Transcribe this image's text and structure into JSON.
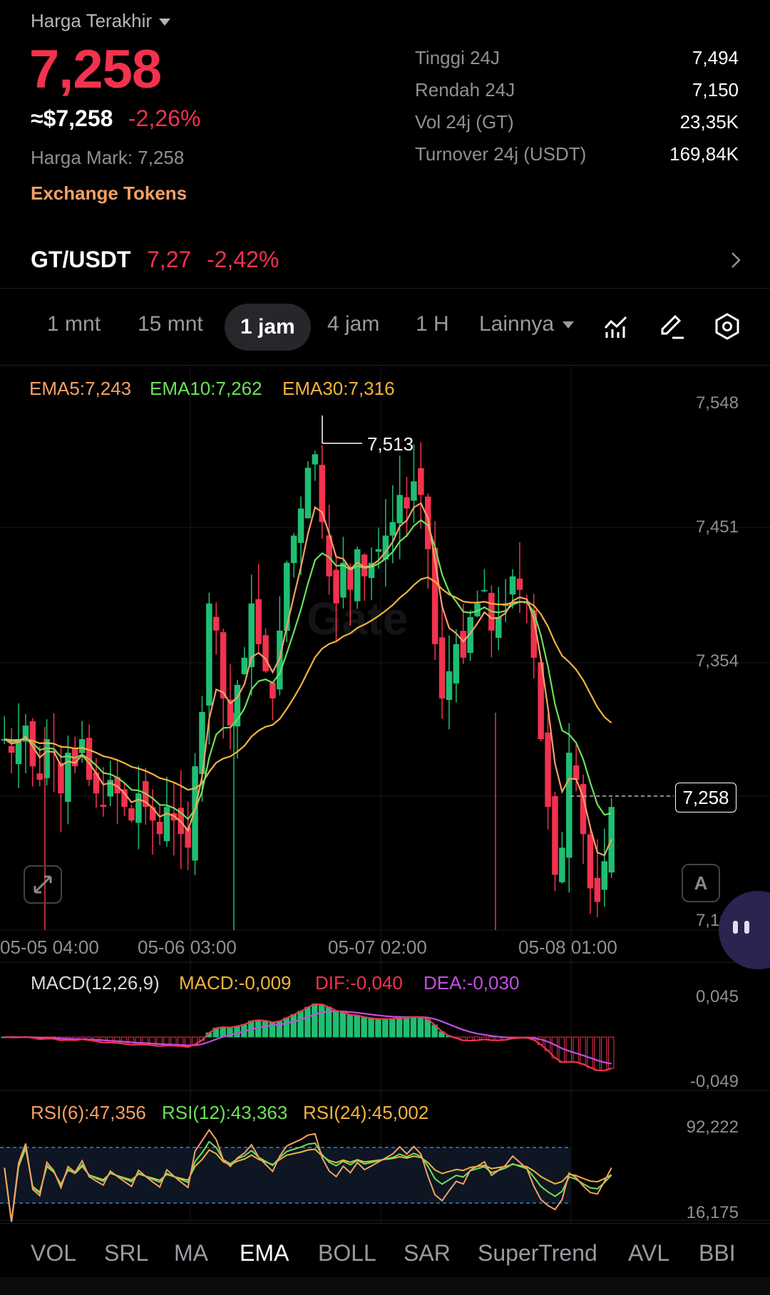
{
  "header": {
    "last_price_label": "Harga Terakhir",
    "last_price": "7,258",
    "usd_price": "≈$7,258",
    "change_pct": "-2,26%",
    "mark_price": "Harga Mark: 7,258",
    "exchange_tokens": "Exchange Tokens"
  },
  "stats": [
    {
      "label": "Tinggi 24J",
      "value": "7,494"
    },
    {
      "label": "Rendah 24J",
      "value": "7,150"
    },
    {
      "label": "Vol 24j (GT)",
      "value": "23,35K"
    },
    {
      "label": "Turnover 24j (USDT)",
      "value": "169,84K"
    }
  ],
  "pair": {
    "name": "GT/USDT",
    "price": "7,27",
    "change": "-2,42%"
  },
  "timeframes": {
    "t1": "1 mnt",
    "t2": "15 mnt",
    "t3": "1 jam",
    "t4": "4 jam",
    "t5": "1 H",
    "more": "Lainnya",
    "selected": "1 jam"
  },
  "chart": {
    "legend": {
      "ema5": "EMA5:7,243",
      "ema10": "EMA10:7,262",
      "ema30": "EMA30:7,316"
    },
    "y_ticks": [
      "7,548",
      "7,451",
      "7,354",
      "7,160"
    ],
    "x_ticks": [
      "05-05 04:00",
      "05-06 03:00",
      "05-07 02:00",
      "05-08 01:00"
    ],
    "high_label": "7,513",
    "current_price_tag": "7,258",
    "auto_label": "A",
    "colors": {
      "up": "#1fbe72",
      "down": "#f2324e",
      "ema5": "#f5a067",
      "ema10": "#6ee05a",
      "ema30": "#f2b33d"
    }
  },
  "macd": {
    "title": "MACD(12,26,9)",
    "macd": "MACD:-0,009",
    "dif": "DIF:-0,040",
    "dea": "DEA:-0,030",
    "y_top": "0,045",
    "y_bottom": "-0,049"
  },
  "rsi": {
    "r6": "RSI(6):47,356",
    "r12": "RSI(12):43,363",
    "r24": "RSI(24):45,002",
    "y_top": "92,222",
    "y_bottom": "16,175"
  },
  "bottom_tabs": {
    "t1": "VOL",
    "t2": "SRL",
    "t3": "MA",
    "t4": "EMA",
    "t5": "BOLL",
    "t6": "SAR",
    "t7": "SuperTrend",
    "t8": "AVL",
    "t9": "BBI",
    "selected": "EMA"
  }
}
